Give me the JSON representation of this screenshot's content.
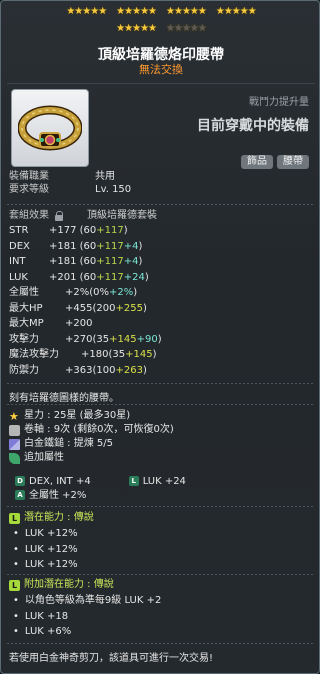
{
  "header": {
    "stars_group_size": 5,
    "star_rows": [
      4,
      2
    ],
    "star_total": 30,
    "star_achieved": 25
  },
  "item": {
    "name": "頂級培羅德烙印腰帶",
    "trade": "無法交換",
    "icon": "belt-icon",
    "combat_label": "戰鬥力提升量",
    "combat_value": "目前穿戴中的裝備",
    "tags": [
      "飾品",
      "腰帶"
    ]
  },
  "requirements": [
    {
      "label": "裝備職業",
      "value": "共用"
    },
    {
      "label": "要求等級",
      "value": "Lv. 150"
    }
  ],
  "set": {
    "label": "套組效果",
    "name": "頂級培羅德套裝"
  },
  "stats": [
    {
      "key": "STR",
      "total": "+177",
      "base": "(60 ",
      "plus": "+117",
      "extra": "",
      "close": ")"
    },
    {
      "key": "DEX",
      "total": "+181",
      "base": "(60 ",
      "plus": "+117",
      "extra": " +4",
      "close": ")"
    },
    {
      "key": "INT",
      "total": "+181",
      "base": "(60 ",
      "plus": "+117",
      "extra": " +4",
      "close": ")"
    },
    {
      "key": "LUK",
      "total": "+201",
      "base": "(60 ",
      "plus": "+117",
      "extra": " +24",
      "close": ")"
    }
  ],
  "stats2": [
    {
      "key": "全屬性",
      "total": "+2%",
      "base": " (0% ",
      "plus": "",
      "extra": "+2%",
      "close": ")"
    },
    {
      "key": "最大HP",
      "total": "+455",
      "base": " (200 ",
      "plus": "+255",
      "extra": "",
      "close": ")"
    },
    {
      "key": "最大MP",
      "total": "+200",
      "base": "",
      "plus": "",
      "extra": "",
      "close": ""
    },
    {
      "key": "攻擊力",
      "total": "+270",
      "base": " (35 ",
      "plus": "+145",
      "extra": " +90",
      "close": ")"
    },
    {
      "key": "魔法攻擊力",
      "total": "+180",
      "base": " (35 ",
      "plus": "+145",
      "extra": "",
      "close": ")"
    },
    {
      "key": "防禦力",
      "total": "+363",
      "base": " (100 ",
      "plus": "+263",
      "extra": "",
      "close": ")"
    }
  ],
  "description": "刻有培羅德圖樣的腰帶。",
  "info": [
    {
      "icon": "star-icon",
      "text": "星力 : 25星 (最多30星)"
    },
    {
      "icon": "scroll-icon",
      "text": "卷軸 : 9次 (剩餘0次，可恢復0次)"
    },
    {
      "icon": "hammer-icon",
      "text": "白金鐵鎚 : 提煉 5/5"
    },
    {
      "icon": "leaf-icon",
      "text": "追加屬性"
    }
  ],
  "additional": {
    "row1": [
      {
        "badge": "D",
        "text": "DEX, INT  +4"
      },
      {
        "badge": "L",
        "text": "LUK  +24"
      }
    ],
    "row2": {
      "badge": "A",
      "text": "全屬性  +2%"
    }
  },
  "potential": {
    "title": "潛在能力 : 傳說",
    "lines": [
      "LUK +12%",
      "LUK +12%",
      "LUK +12%"
    ]
  },
  "bonus_potential": {
    "title": "附加潛在能力 : 傳說",
    "lines": [
      "以角色等級為準每9級 LUK +2",
      "LUK +18",
      "LUK +6%"
    ]
  },
  "footer": "若使用白金神奇剪刀，該道具可進行一次交易!",
  "colors": {
    "trade": "#ff9a2e",
    "star": "#f7c93c",
    "upgrade": "#b8d94a",
    "extra": "#7ce6d6",
    "potential": "#a6d93a"
  }
}
